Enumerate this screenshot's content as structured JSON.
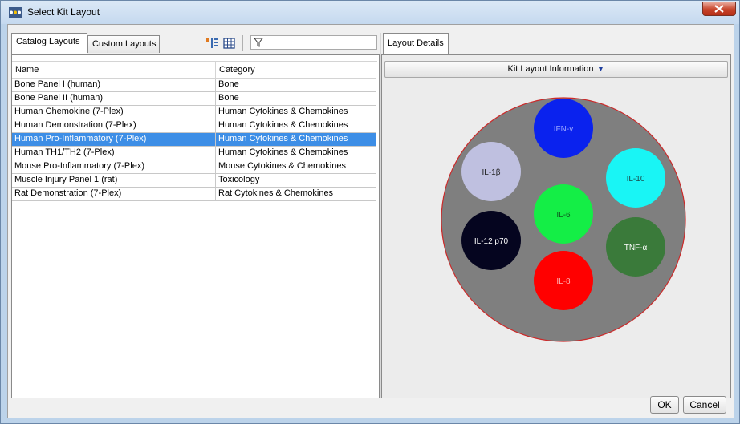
{
  "window": {
    "title": "Select Kit Layout"
  },
  "left": {
    "tabs": [
      {
        "label": "Catalog Layouts",
        "active": true
      },
      {
        "label": "Custom Layouts",
        "active": false
      }
    ],
    "toolbar_icons": [
      "sort-columns-icon",
      "grid-view-icon",
      "filter-icon"
    ],
    "filter_value": "",
    "columns": [
      "Name",
      "Category"
    ],
    "rows": [
      {
        "name": "Bone Panel I (human)",
        "category": "Bone"
      },
      {
        "name": "Bone Panel II (human)",
        "category": "Bone"
      },
      {
        "name": "Human Chemokine (7-Plex)",
        "category": "Human Cytokines & Chemokines"
      },
      {
        "name": "Human Demonstration (7-Plex)",
        "category": "Human Cytokines & Chemokines"
      },
      {
        "name": "Human Pro-Inflammatory (7-Plex)",
        "category": "Human Cytokines & Chemokines",
        "selected": true
      },
      {
        "name": "Human TH1/TH2 (7-Plex)",
        "category": "Human Cytokines & Chemokines"
      },
      {
        "name": "Mouse Pro-Inflammatory (7-Plex)",
        "category": "Mouse Cytokines & Chemokines"
      },
      {
        "name": "Muscle Injury Panel 1 (rat)",
        "category": "Toxicology"
      },
      {
        "name": "Rat Demonstration (7-Plex)",
        "category": "Rat Cytokines & Chemokines"
      }
    ]
  },
  "right": {
    "tab_label": "Layout Details",
    "info_label": "Kit Layout Information",
    "info_arrow": "▼",
    "beads": [
      {
        "label": "IFN-γ",
        "color": "#0a22ee",
        "text_color": "#9aa6ff"
      },
      {
        "label": "IL-1β",
        "color": "#bfc0e0",
        "text_color": "#222222"
      },
      {
        "label": "IL-10",
        "color": "#19f5f5",
        "text_color": "#1a4a4a"
      },
      {
        "label": "IL-6",
        "color": "#14ee46",
        "text_color": "#0e5a20"
      },
      {
        "label": "IL-12 p70",
        "color": "#05051f",
        "text_color": "#ffffff"
      },
      {
        "label": "TNF-α",
        "color": "#3a7a3a",
        "text_color": "#ffffff"
      },
      {
        "label": "IL-8",
        "color": "#ff0000",
        "text_color": "#ffb0b0"
      }
    ]
  },
  "buttons": {
    "ok": "OK",
    "cancel": "Cancel"
  }
}
